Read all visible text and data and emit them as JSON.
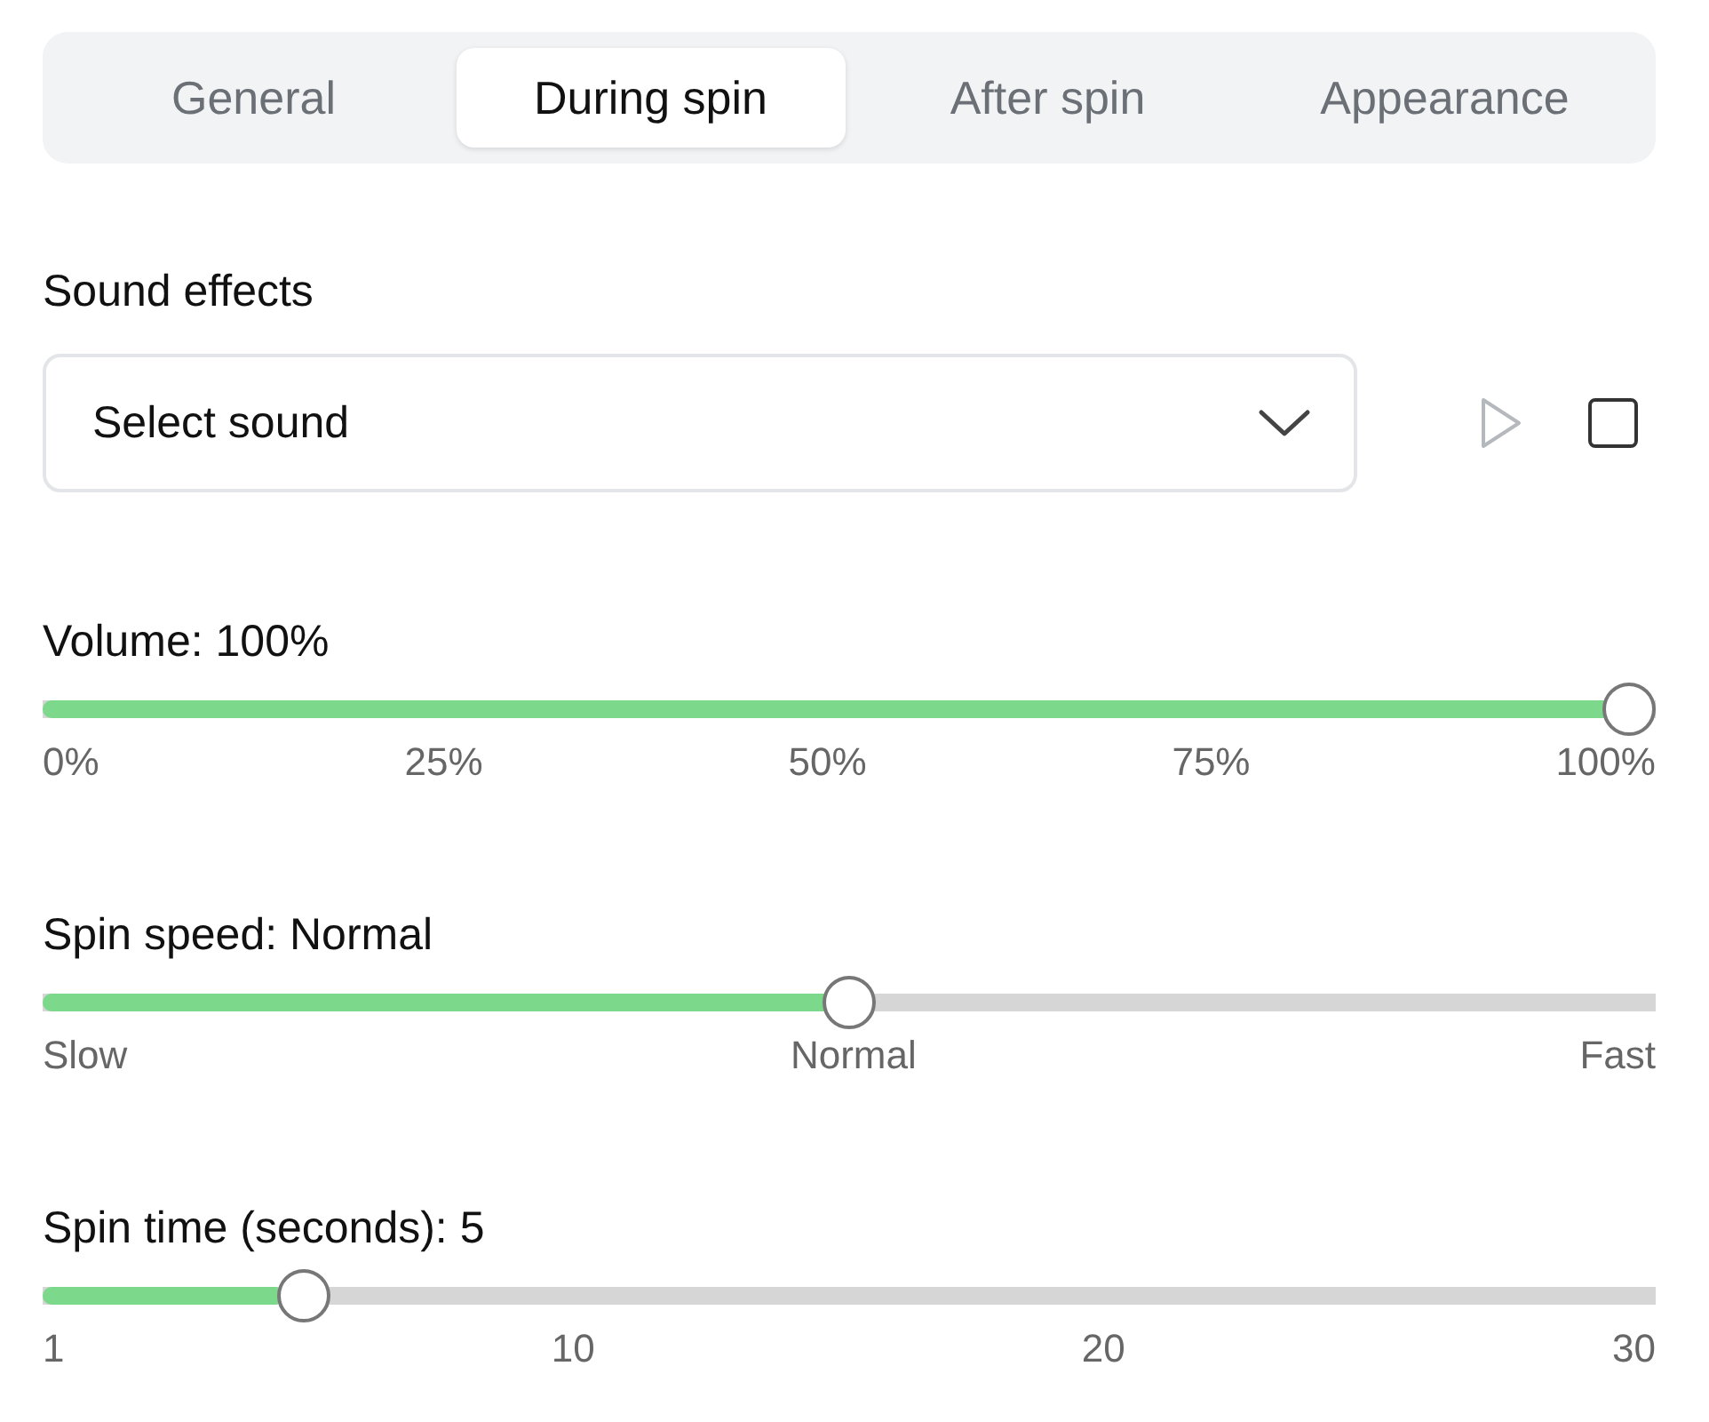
{
  "tabs": [
    {
      "label": "General",
      "selected": false
    },
    {
      "label": "During spin",
      "selected": true
    },
    {
      "label": "After spin",
      "selected": false
    },
    {
      "label": "Appearance",
      "selected": false
    }
  ],
  "sound_effects": {
    "label": "Sound effects",
    "select": {
      "placeholder": "Select sound"
    },
    "play_disabled": true,
    "checked": false
  },
  "sliders": [
    {
      "label": "Volume: 100%",
      "level": 1,
      "ticks": [
        "0%",
        "25%",
        "50%",
        "75%",
        "100%"
      ]
    },
    {
      "label": "Spin speed: Normal",
      "level": 0.5,
      "ticks": [
        "Slow",
        "Normal",
        "Fast"
      ]
    },
    {
      "label": "Spin time (seconds): 5",
      "level": 0.15,
      "ticks": [
        "1",
        "10",
        "20",
        "30"
      ]
    }
  ]
}
